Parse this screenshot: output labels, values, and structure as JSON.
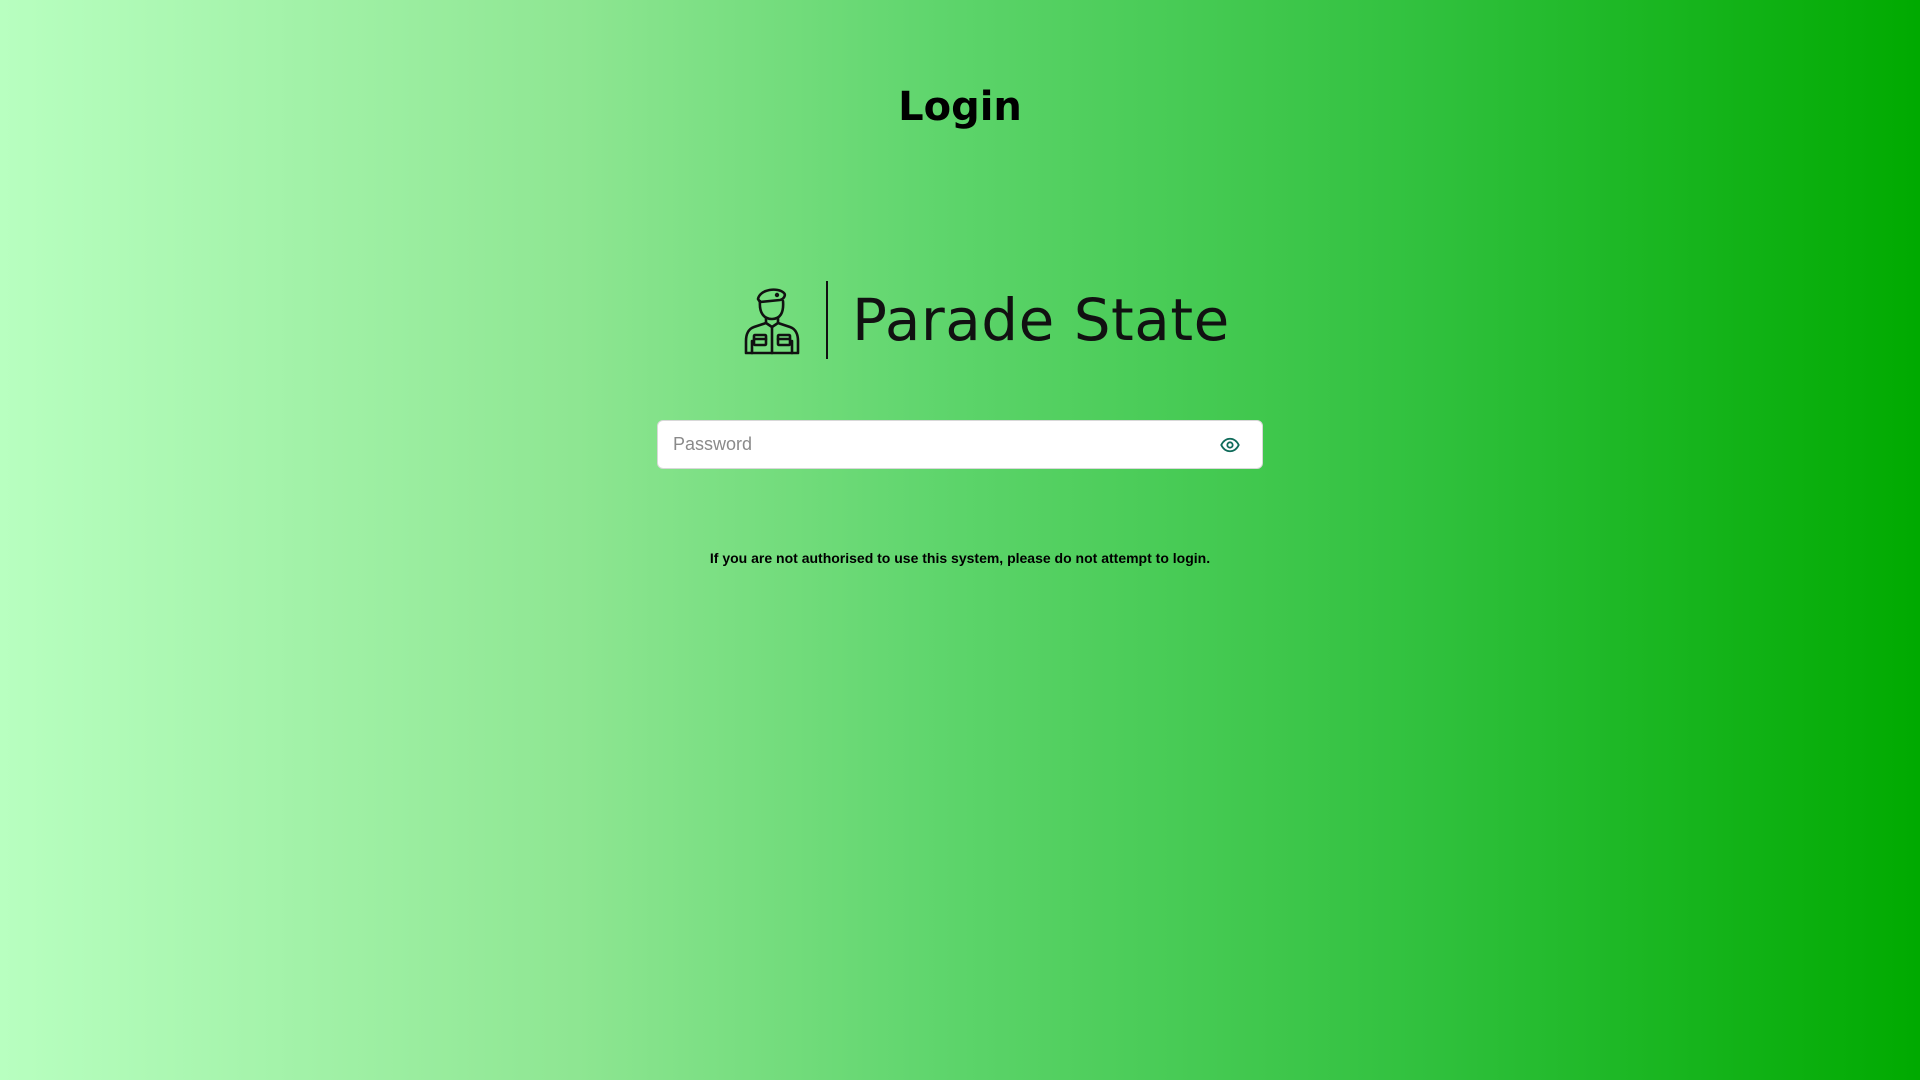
{
  "page": {
    "title": "Login",
    "background_gradient": [
      "#b8ffc0",
      "#00aa00"
    ]
  },
  "logo": {
    "icon": "soldier-icon",
    "text": "Parade State"
  },
  "password": {
    "placeholder": "Password",
    "value": "",
    "toggle_icon": "eye-icon",
    "toggle_color": "#0f6b5a"
  },
  "notice": {
    "text": "If you are not authorised to use this system, please do not attempt to login."
  }
}
